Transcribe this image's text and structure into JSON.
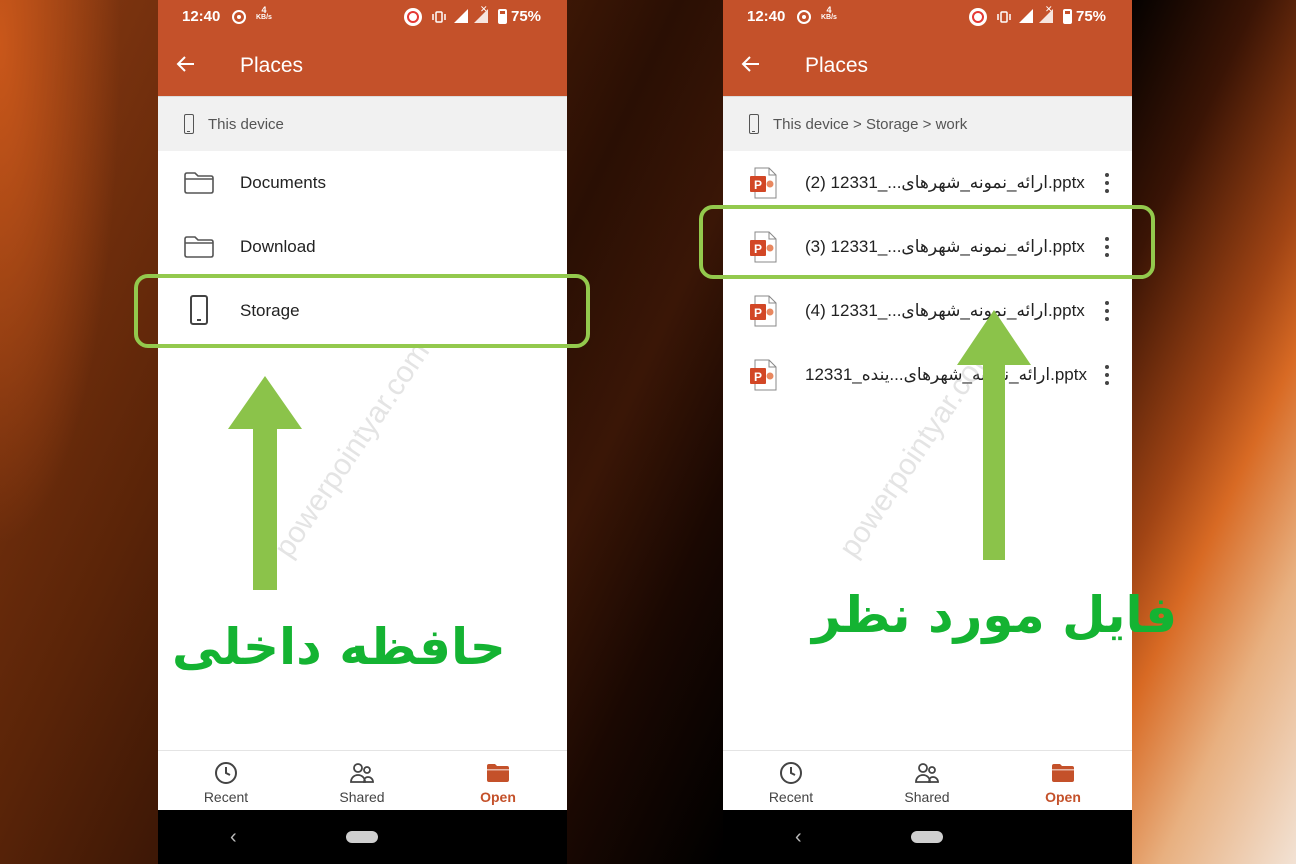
{
  "colors": {
    "appbar": "#c4512a",
    "accent": "#c4512a",
    "highlight": "#93c94d",
    "arrow": "#8bc34a",
    "caption": "#14b332"
  },
  "status_bar": {
    "time": "12:40",
    "net_speed_value": "4",
    "net_speed_unit": "KB/s",
    "battery": "75%"
  },
  "left_screen": {
    "title": "Places",
    "breadcrumb": "This device",
    "items": [
      {
        "label": "Documents",
        "icon": "folder-icon"
      },
      {
        "label": "Download",
        "icon": "folder-icon"
      },
      {
        "label": "Storage",
        "icon": "phone-device-icon"
      }
    ],
    "watermark": "powerpointyar.com",
    "caption": "حافظه داخلی"
  },
  "right_screen": {
    "title": "Places",
    "breadcrumb": "This device > Storage > work",
    "files": [
      {
        "name": "ارائه_نمونه_شهرهای..._12331 (2).pptx",
        "icon": "powerpoint-file-icon"
      },
      {
        "name": "ارائه_نمونه_شهرهای..._12331 (3).pptx",
        "icon": "powerpoint-file-icon"
      },
      {
        "name": "ارائه_نمونه_شهرهای..._12331 (4).pptx",
        "icon": "powerpoint-file-icon"
      },
      {
        "name": "ارائه_نمونه_شهرهای...ینده_12331.pptx",
        "icon": "powerpoint-file-icon"
      }
    ],
    "watermark": "powerpointyar.com",
    "caption": "فایل مورد نظر"
  },
  "bottom_nav": {
    "recent": "Recent",
    "shared": "Shared",
    "open": "Open",
    "active": "open"
  }
}
